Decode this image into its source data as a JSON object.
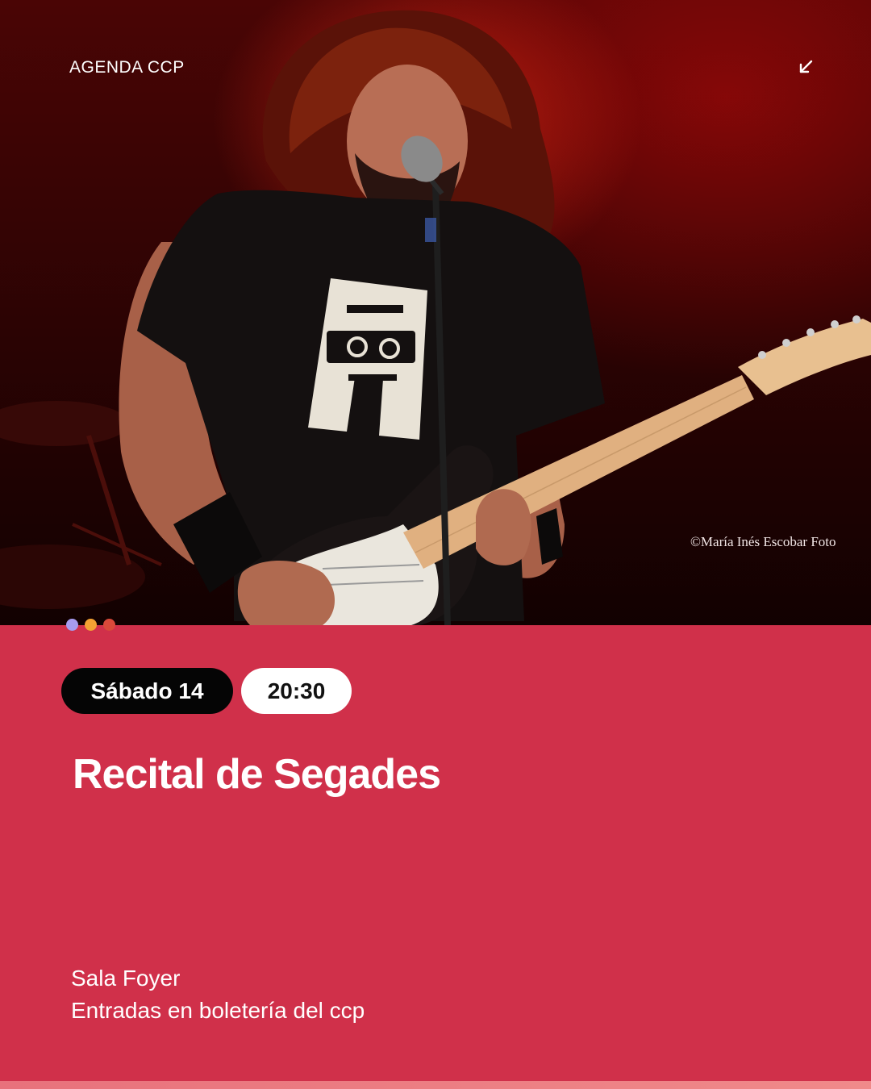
{
  "header": {
    "brand": "AGENDA CCP",
    "corner_icon": "arrow-down-left-icon"
  },
  "photo": {
    "credit": "©María Inés Escobar Foto"
  },
  "indicator": {
    "dot_colors": [
      "#a79cf0",
      "#f4a233",
      "#d9493a"
    ]
  },
  "event": {
    "day": "Sábado 14",
    "time": "20:30",
    "title": "Recital de Segades",
    "venue": "Sala Foyer",
    "tickets": "Entradas en boletería del ccp"
  },
  "colors": {
    "panel": "#d0304a",
    "day_pill": "#050505",
    "time_pill": "#ffffff",
    "text": "#ffffff"
  }
}
